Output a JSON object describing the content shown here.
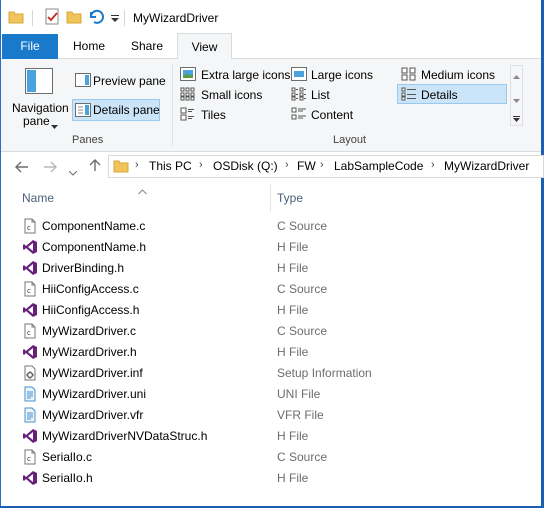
{
  "window": {
    "title": "MyWizardDriver"
  },
  "ribbon_tabs": [
    "File",
    "Home",
    "Share",
    "View"
  ],
  "panes": {
    "navigation_pane_label1": "Navigation",
    "navigation_pane_label2": "pane",
    "preview_pane": "Preview pane",
    "details_pane": "Details pane",
    "group_label": "Panes"
  },
  "layout": {
    "extra_large_icons": "Extra large icons",
    "large_icons": "Large icons",
    "medium_icons": "Medium icons",
    "small_icons": "Small icons",
    "list": "List",
    "details": "Details",
    "tiles": "Tiles",
    "content": "Content",
    "group_label": "Layout"
  },
  "address": {
    "crumbs": [
      "This PC",
      "OSDisk (Q:)",
      "FW",
      "LabSampleCode",
      "MyWizardDriver"
    ]
  },
  "columns": {
    "name": "Name",
    "type": "Type"
  },
  "files": [
    {
      "name": "ComponentName.c",
      "type": "C Source",
      "icon": "c-source-icon"
    },
    {
      "name": "ComponentName.h",
      "type": "H File",
      "icon": "h-file-icon"
    },
    {
      "name": "DriverBinding.h",
      "type": "H File",
      "icon": "h-file-icon"
    },
    {
      "name": "HiiConfigAccess.c",
      "type": "C Source",
      "icon": "c-source-icon"
    },
    {
      "name": "HiiConfigAccess.h",
      "type": "H File",
      "icon": "h-file-icon"
    },
    {
      "name": "MyWizardDriver.c",
      "type": "C Source",
      "icon": "c-source-icon"
    },
    {
      "name": "MyWizardDriver.h",
      "type": "H File",
      "icon": "h-file-icon"
    },
    {
      "name": "MyWizardDriver.inf",
      "type": "Setup Information",
      "icon": "setup-info-icon"
    },
    {
      "name": "MyWizardDriver.uni",
      "type": "UNI File",
      "icon": "uni-file-icon"
    },
    {
      "name": "MyWizardDriver.vfr",
      "type": "VFR File",
      "icon": "vfr-file-icon"
    },
    {
      "name": "MyWizardDriverNVDataStruc.h",
      "type": "H File",
      "icon": "h-file-icon"
    },
    {
      "name": "SerialIo.c",
      "type": "C Source",
      "icon": "c-source-icon"
    },
    {
      "name": "SerialIo.h",
      "type": "H File",
      "icon": "h-file-icon"
    }
  ],
  "colors": {
    "accent": "#1979ca",
    "selection": "#cce4f7",
    "vs_purple": "#68217a"
  }
}
